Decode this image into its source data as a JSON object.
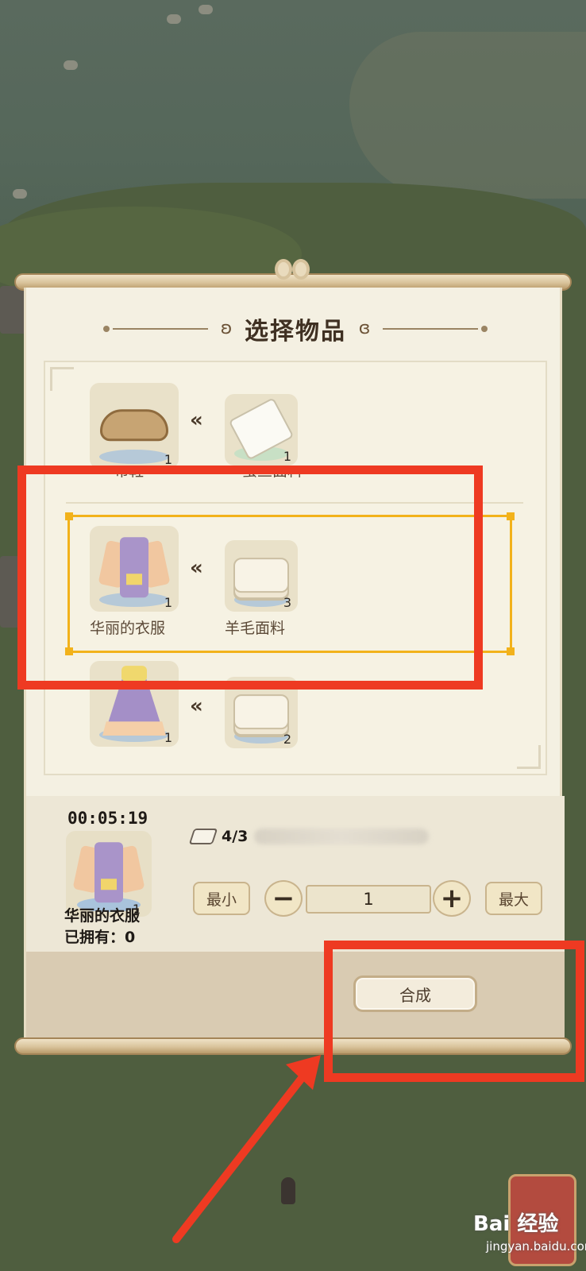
{
  "panel": {
    "title": "选择物品"
  },
  "recipes": [
    {
      "output_name": "布鞋",
      "output_qty": "1",
      "input_name": "蚕丝面料",
      "input_qty": "1"
    },
    {
      "output_name": "华丽的衣服",
      "output_qty": "1",
      "input_name": "羊毛面料",
      "input_qty": "3",
      "selected": true
    },
    {
      "output_name": "",
      "output_qty": "1",
      "input_name": "",
      "input_qty": "2"
    }
  ],
  "detail": {
    "timer": "00:05:19",
    "item_name": "华丽的衣服",
    "item_qty": "1",
    "owned_text": "已拥有：0",
    "material_count": "4/3",
    "min_label": "最小",
    "max_label": "最大",
    "minus_label": "−",
    "plus_label": "+",
    "quantity": "1"
  },
  "footer": {
    "craft_label": "合成"
  },
  "watermark": {
    "brand": "Bai 经验",
    "url": "jingyan.baidu.com"
  },
  "colors": {
    "highlight": "#f2b21b",
    "annotation_red": "#ee3a22",
    "panel_bg": "#f4f0e2"
  }
}
